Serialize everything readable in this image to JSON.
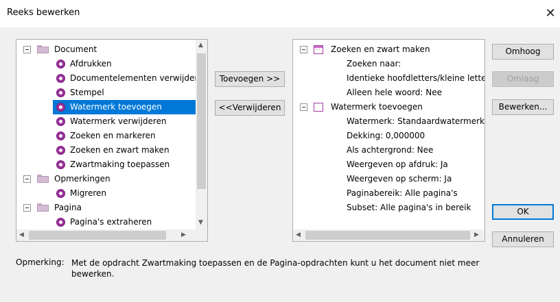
{
  "window": {
    "title": "Reeks bewerken",
    "close_glyph": "✕"
  },
  "left_tree": {
    "groups": [
      {
        "label": "Document",
        "items": [
          "Afdrukken",
          "Documentelementen verwijderen",
          "Stempel",
          "Watermerk toevoegen",
          "Watermerk verwijderen",
          "Zoeken en markeren",
          "Zoeken en zwart maken",
          "Zwartmaking toepassen"
        ]
      },
      {
        "label": "Opmerkingen",
        "items": [
          "Migreren"
        ]
      },
      {
        "label": "Pagina",
        "items": [
          "Pagina's extraheren"
        ]
      }
    ],
    "selected_item": "Watermerk toevoegen"
  },
  "middle_buttons": {
    "add_label": "Toevoegen >>",
    "remove_label": "<<Verwijderen"
  },
  "right_tree": {
    "commands": [
      {
        "label": "Zoeken en zwart maken",
        "details": [
          "Zoeken naar:",
          "Identieke hoofdletters/kleine letters",
          "Alleen hele woord: Nee"
        ]
      },
      {
        "label": "Watermerk toevoegen",
        "details": [
          "Watermerk: Standaardwatermerk",
          "Dekking: 0,000000",
          "Als achtergrond: Nee",
          "Weergeven op afdruk: Ja",
          "Weergeven op scherm: Ja",
          "Paginabereik: Alle pagina's",
          "Subset: Alle pagina's in bereik"
        ]
      }
    ]
  },
  "side_buttons": {
    "up_label": "Omhoog",
    "down_label": "Omlaag",
    "edit_label": "Bewerken...",
    "ok_label": "OK",
    "cancel_label": "Annuleren"
  },
  "note": {
    "label": "Opmerking:",
    "text": "Met de opdracht Zwartmaking toepassen en de Pagina-opdrachten kunt u het document niet meer bewerken."
  },
  "scroll_arrows": {
    "up": "▲",
    "down": "▼",
    "left": "◀",
    "right": "▶"
  }
}
